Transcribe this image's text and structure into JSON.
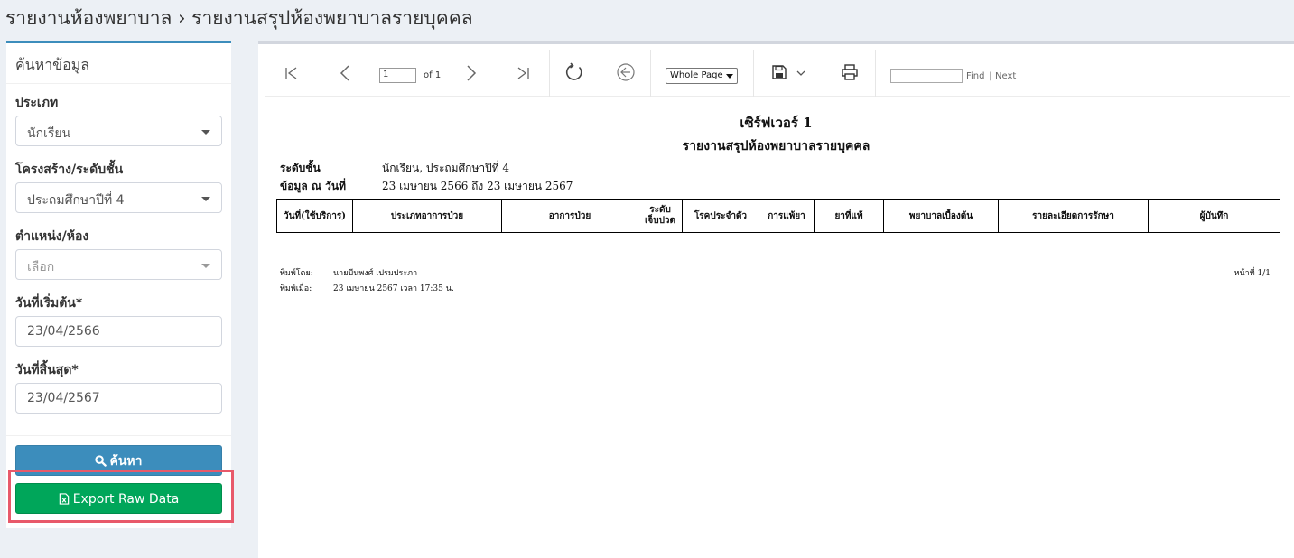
{
  "header": {
    "title": "รายงานห้องพยาบาล › รายงานสรุปห้องพยาบาลรายบุคคล"
  },
  "search_panel": {
    "title": "ค้นหาข้อมูล",
    "type_label": "ประเภท",
    "type_value": "นักเรียน",
    "structure_label": "โครงสร้าง/ระดับชั้น",
    "structure_value": "ประถมศึกษาปีที่ 4",
    "position_label": "ตำแหน่ง/ห้อง",
    "position_value": "เลือก",
    "start_date_label": "วันที่เริ่มต้น*",
    "start_date_value": "23/04/2566",
    "end_date_label": "วันที่สิ้นสุด*",
    "end_date_value": "23/04/2567",
    "search_button": "ค้นหา",
    "export_button": "Export Raw Data"
  },
  "toolbar": {
    "page_input": "1",
    "page_of": "of 1",
    "zoom": "Whole Page",
    "find_label": "Find",
    "separator": "|",
    "next_label": "Next"
  },
  "report": {
    "title": "เซิร์ฟเวอร์ 1",
    "subtitle": "รายงานสรุปห้องพยาบาลรายบุคคล",
    "level_label": "ระดับชั้น",
    "level_value": "นักเรียน, ประถมศึกษาปีที่ 4",
    "date_label": "ข้อมูล ณ วันที่",
    "date_value": "23 เมษายน 2566 ถึง 23 เมษายน 2567",
    "columns": [
      "วันที่(ใช้บริการ)",
      "ประเภทอาการป่วย",
      "อาการป่วย",
      "ระดับเจ็บปวด",
      "โรคประจำตัว",
      "การแพ้ยา",
      "ยาที่แพ้",
      "พยาบาลเบื้องต้น",
      "รายละเอียดการรักษา",
      "ผู้บันทึก"
    ],
    "column_3_line1": "ระดับ",
    "column_3_line2": "เจ็บปวด",
    "printed_by_label": "พิมพ์โดย:",
    "printed_by_value": "นายบีนพงศ์ เปรมประภา",
    "printed_at_label": "พิมพ์เมื่อ:",
    "printed_at_value": "23 เมษายน 2567 เวลา 17:35 น.",
    "page_info": "หน้าที่ 1/1"
  }
}
